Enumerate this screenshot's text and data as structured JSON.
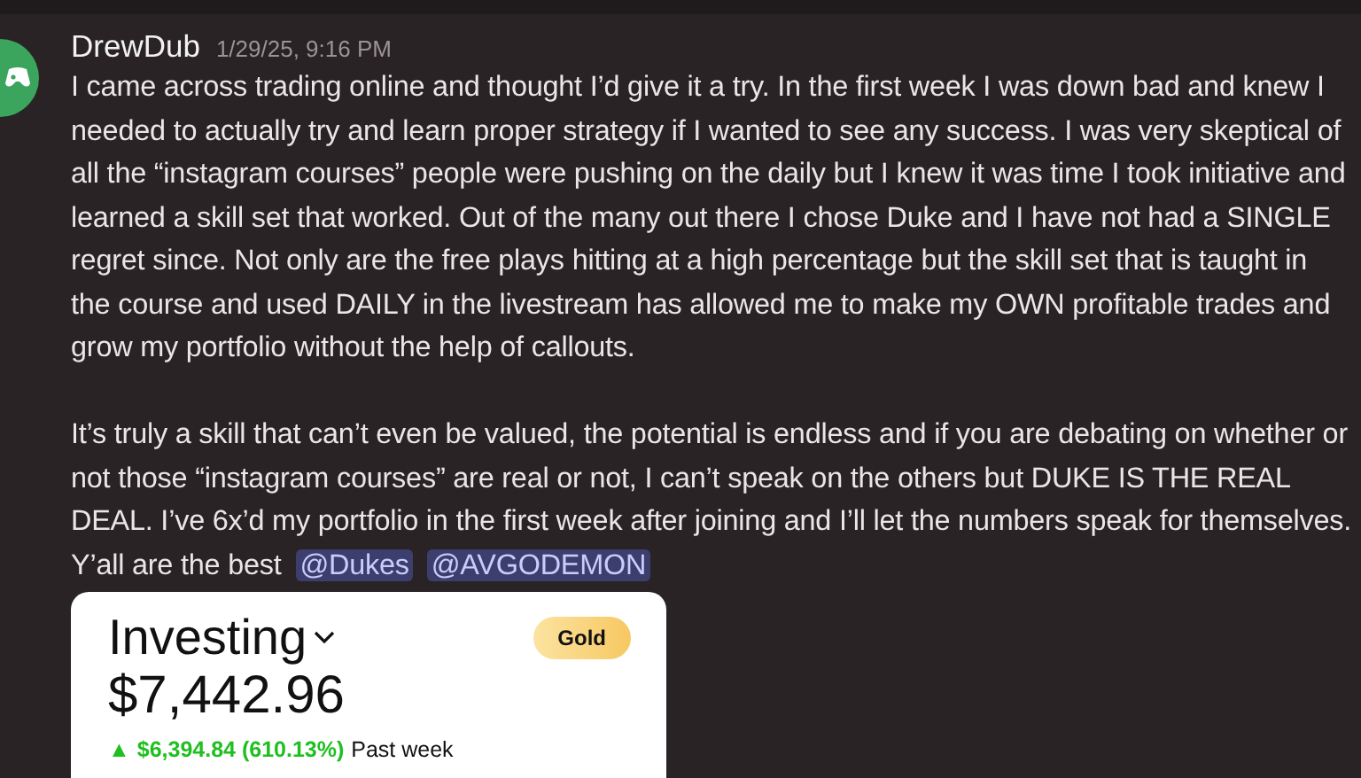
{
  "message": {
    "author": "DrewDub",
    "timestamp": "1/29/25, 9:16 PM",
    "paragraphs": [
      {
        "text": "I came across trading online and thought I’d give it a try. In the first week I was down bad and knew I needed to actually try and learn proper strategy if I wanted to see any success. I was very skeptical of all the “instagram courses” people were pushing on the daily but I knew it was time I took initiative and learned a skill set that worked. Out of the many out there I chose Duke and I have not had a SINGLE regret since. Not only are the free plays hitting at a high percentage but the skill set that is taught in the course and used DAILY in the livestream has allowed me to make my OWN profitable trades and grow my portfolio without the help of callouts."
      },
      {
        "text": "It’s truly a skill that can’t even be valued, the potential is endless and if you are debating on whether or not those “instagram courses” are real or not, I can’t speak on the others but DUKE IS THE REAL DEAL. I’ve 6x’d my portfolio in the first week after joining and I’ll let the numbers speak for themselves. Y’all are the best",
        "mentions": [
          "@Dukes",
          "@AVGODEMON"
        ]
      }
    ],
    "attachment": {
      "title": "Investing",
      "badge": "Gold",
      "balance": "$7,442.96",
      "change_icon": "▲",
      "change": "$6,394.84 (610.13%)",
      "period": "Past week"
    }
  }
}
